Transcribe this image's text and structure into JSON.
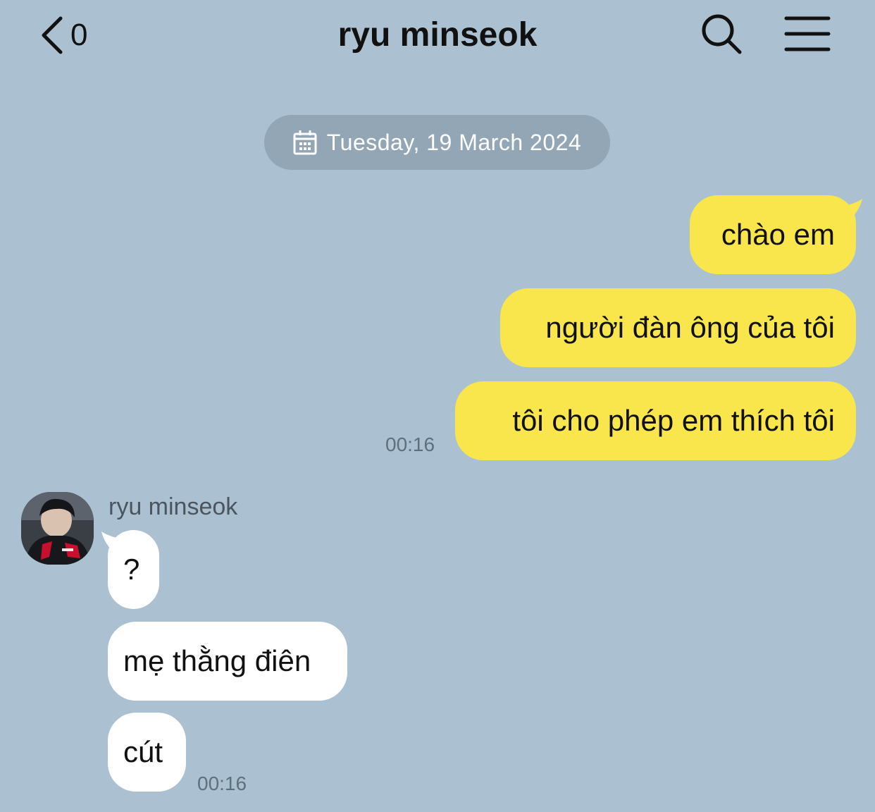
{
  "header": {
    "back_count": "0",
    "title": "ryu minseok"
  },
  "date_separator": {
    "label": "Tuesday, 19 March 2024"
  },
  "sent_messages": [
    {
      "text": "chào em"
    },
    {
      "text": "người đàn ông của tôi"
    },
    {
      "text": "tôi cho phép em thích tôi"
    }
  ],
  "sent_time": "00:16",
  "received": {
    "sender_name": "ryu minseok",
    "messages": [
      {
        "text": "?"
      },
      {
        "text": "mẹ thằng điên"
      },
      {
        "text": "cút"
      }
    ],
    "time": "00:16"
  },
  "colors": {
    "background": "#abc1d1",
    "sent_bubble": "#f8e64c",
    "received_bubble": "#ffffff",
    "date_pill": "#93a6b5"
  },
  "icons": {
    "back": "chevron-left-icon",
    "search": "search-icon",
    "menu": "hamburger-menu-icon",
    "date": "calendar-icon"
  }
}
